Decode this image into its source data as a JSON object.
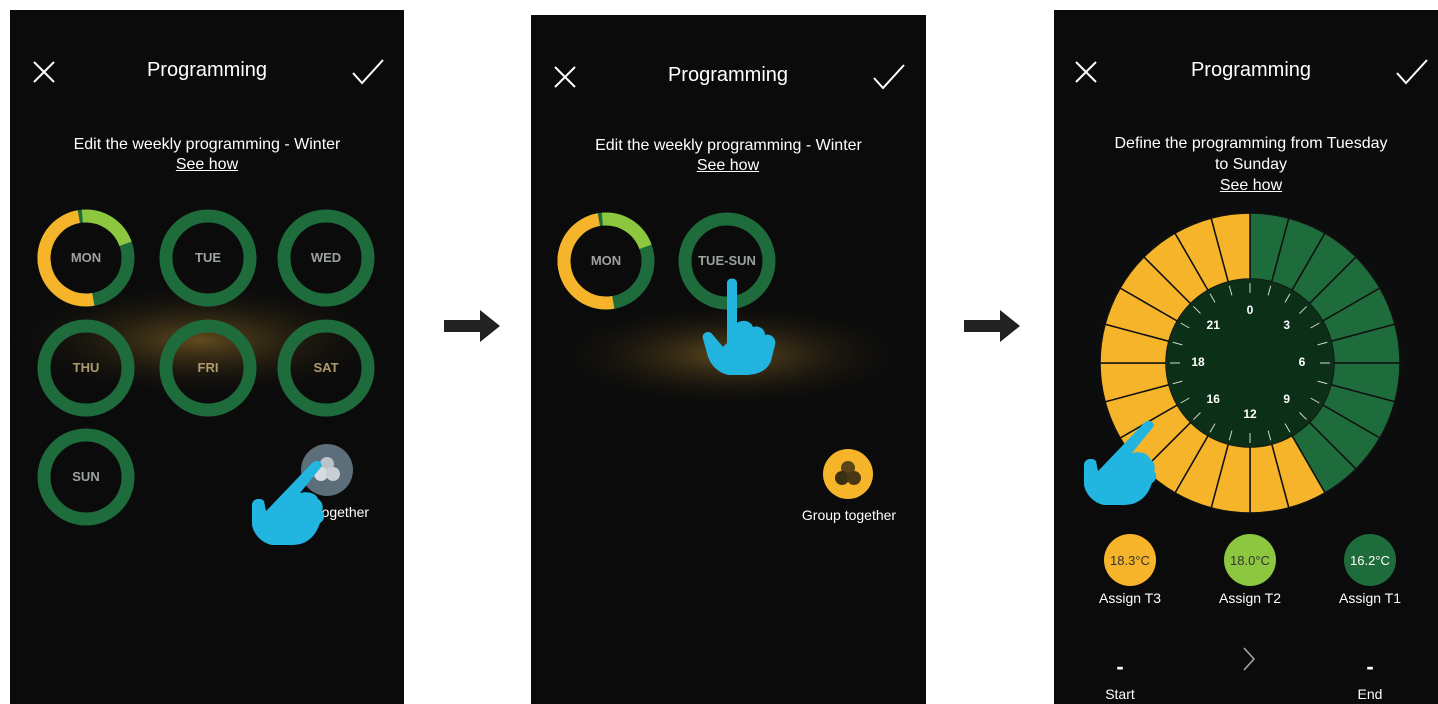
{
  "colors": {
    "yellow": "#f5b42a",
    "lime": "#8dc63f",
    "green": "#1e6b3c",
    "dark": "#0b0b0b",
    "cyan": "#1fb3e3"
  },
  "screen1": {
    "title": "Programming",
    "subtitle": "Edit the weekly programming - Winter",
    "see_how": "See how",
    "days": [
      "MON",
      "TUE",
      "WED",
      "THU",
      "FRI",
      "SAT",
      "SUN"
    ],
    "group_label": "Group together",
    "group_label_visible": "p together",
    "icons": [
      "close-icon",
      "check-icon",
      "group-icon",
      "hand-pointer-icon"
    ]
  },
  "screen2": {
    "title": "Programming",
    "subtitle": "Edit the weekly programming - Winter",
    "see_how": "See how",
    "days": [
      "MON",
      "TUE-SUN"
    ],
    "group_label": "Group together"
  },
  "screen3": {
    "title": "Programming",
    "subtitle_line1": "Define the programming from Tuesday",
    "subtitle_line2": "to Sunday",
    "see_how": "See how",
    "clock_hours": [
      "0",
      "3",
      "6",
      "9",
      "12",
      "16",
      "18",
      "21"
    ],
    "temps": [
      {
        "value": "18.3°C",
        "label": "Assign T3",
        "color": "#f5b42a"
      },
      {
        "value": "18.0°C",
        "label": "Assign T2",
        "color": "#8dc63f"
      },
      {
        "value": "16.2°C",
        "label": "Assign T1",
        "color": "#1e6b3c"
      }
    ],
    "start_value": "-",
    "start_label": "Start",
    "end_value": "-",
    "end_label": "End"
  }
}
